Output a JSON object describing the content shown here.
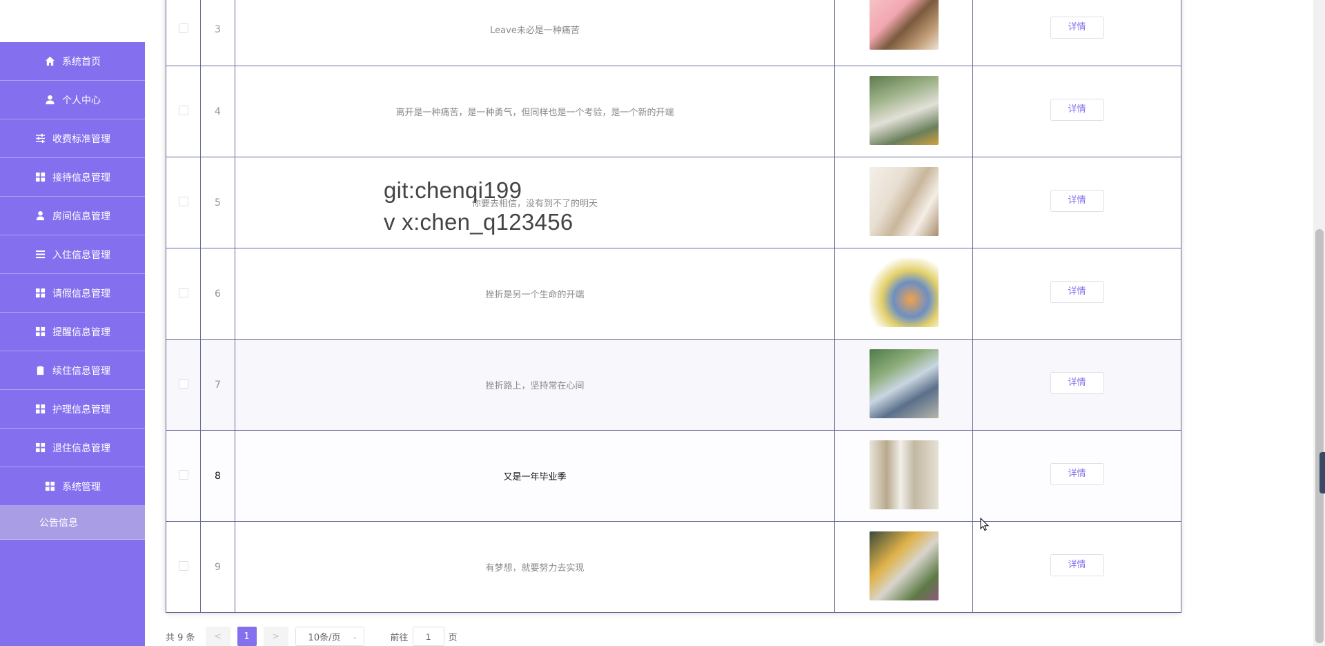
{
  "sidebar": {
    "items": [
      {
        "label": "系统首页",
        "icon": "home-icon"
      },
      {
        "label": "个人中心",
        "icon": "user-icon"
      },
      {
        "label": "收费标准管理",
        "icon": "sliders-icon"
      },
      {
        "label": "接待信息管理",
        "icon": "grid-icon"
      },
      {
        "label": "房间信息管理",
        "icon": "person-icon"
      },
      {
        "label": "入住信息管理",
        "icon": "list-icon"
      },
      {
        "label": "请假信息管理",
        "icon": "grid-icon"
      },
      {
        "label": "提醒信息管理",
        "icon": "grid-icon"
      },
      {
        "label": "续住信息管理",
        "icon": "clipboard-icon"
      },
      {
        "label": "护理信息管理",
        "icon": "grid-icon"
      },
      {
        "label": "退住信息管理",
        "icon": "grid-icon"
      },
      {
        "label": "系统管理",
        "icon": "grid-icon"
      }
    ],
    "subitem": {
      "label": "公告信息"
    }
  },
  "table": {
    "detail_label": "详情",
    "rows": [
      {
        "index": "3",
        "title": "Leave未必是一种痛苦",
        "image": "piggy-bank-elder-image"
      },
      {
        "index": "4",
        "title": "离开是一种痛苦，是一种勇气，但同样也是一个考验，是一个新的开端",
        "image": "elderly-couple-greenhouse-image"
      },
      {
        "index": "5",
        "title": "你要去相信，没有到不了的明天",
        "image": "caregiver-elder-image"
      },
      {
        "index": "6",
        "title": "挫折是另一个生命的开端",
        "image": "elder-care-service-image"
      },
      {
        "index": "7",
        "title": "挫折路上，坚持常在心间",
        "image": "wheelchair-park-image"
      },
      {
        "index": "8",
        "title": "又是一年毕业季",
        "image": "elderly-group-image"
      },
      {
        "index": "9",
        "title": "有梦想，就要努力去实现",
        "image": "elder-reading-image"
      }
    ]
  },
  "watermark": {
    "line1": "git:chenqi199",
    "line2": "v x:chen_q123456"
  },
  "pagination": {
    "total": "共 9 条",
    "prev": "<",
    "current": "1",
    "next": ">",
    "page_size": "10条/页",
    "goto_label": "前往",
    "goto_value": "1",
    "page_suffix": "页"
  },
  "colors": {
    "accent": "#8470ee",
    "sidebar_sub": "#a99de6",
    "border": "#646796"
  }
}
